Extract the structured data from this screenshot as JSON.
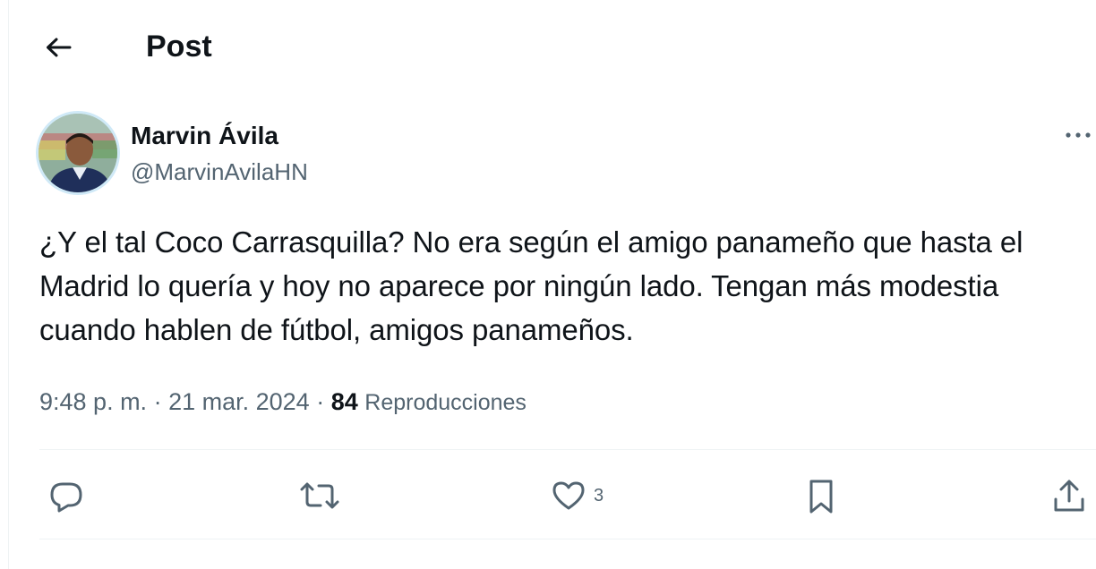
{
  "header": {
    "title": "Post",
    "back_icon": "arrow-left-icon"
  },
  "author": {
    "display_name": "Marvin Ávila",
    "handle": "@MarvinAvilaHN",
    "avatar_icon": "avatar"
  },
  "post": {
    "text": "¿Y el tal Coco Carrasquilla? No era según el amigo panameño que hasta el Madrid lo quería y hoy no aparece por ningún lado. Tengan más modestia cuando hablen de fútbol, amigos panameños."
  },
  "meta": {
    "time": "9:48 p. m.",
    "separator": " · ",
    "date": "21 mar. 2024",
    "views_count": "84",
    "views_label": "Reproducciones"
  },
  "actions": {
    "reply_icon": "reply-icon",
    "repost_icon": "repost-icon",
    "like_icon": "heart-icon",
    "like_count": "3",
    "bookmark_icon": "bookmark-icon",
    "share_icon": "share-icon"
  },
  "colors": {
    "text_primary": "#0f1419",
    "text_secondary": "#536471",
    "divider": "#eff3f4"
  }
}
